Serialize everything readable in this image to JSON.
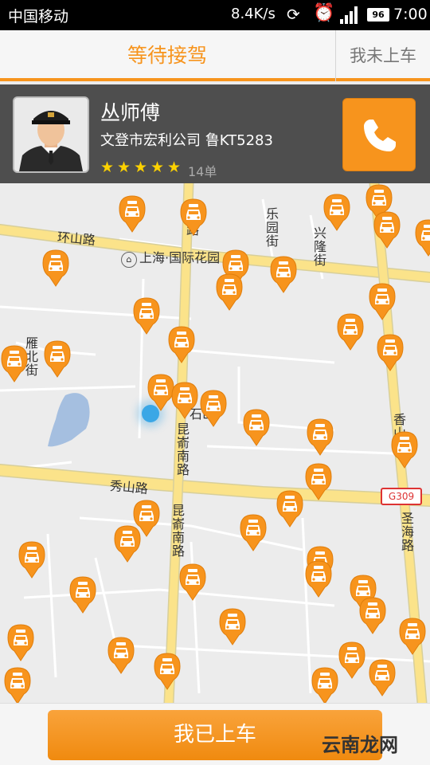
{
  "status_bar": {
    "carrier": "中国移动",
    "speed": "8.4K/s",
    "battery": "96",
    "time": "7:00"
  },
  "header": {
    "title": "等待接驾",
    "right_action": "我未上车"
  },
  "driver": {
    "name": "丛师傅",
    "company_plate": "文登市宏利公司 鲁KT5283",
    "rating_stars": 5,
    "order_count": "14单"
  },
  "map": {
    "roads": {
      "huanshan": "环山路",
      "xiushan": "秀山路",
      "kunyu_south_1": "昆嵛南路",
      "kunyu_south_2": "昆嵛南路",
      "leyuan": "乐园街",
      "xinglong": "兴隆街",
      "yanbei": "雁北街",
      "shenghai": "圣海路",
      "xiangshan": "香山路",
      "kunyu_top": "路",
      "shidong": "石山"
    },
    "poi": "上海·国际花园",
    "highway": "G309"
  },
  "footer": {
    "board_button": "我已上车",
    "watermark": "云南龙网"
  },
  "colors": {
    "accent": "#f7941d",
    "driver_card_bg": "#464646",
    "road_yellow": "#fbe38a",
    "road_white": "#ffffff",
    "user_location": "#3ba7e6",
    "lake": "#a5bfe0"
  }
}
